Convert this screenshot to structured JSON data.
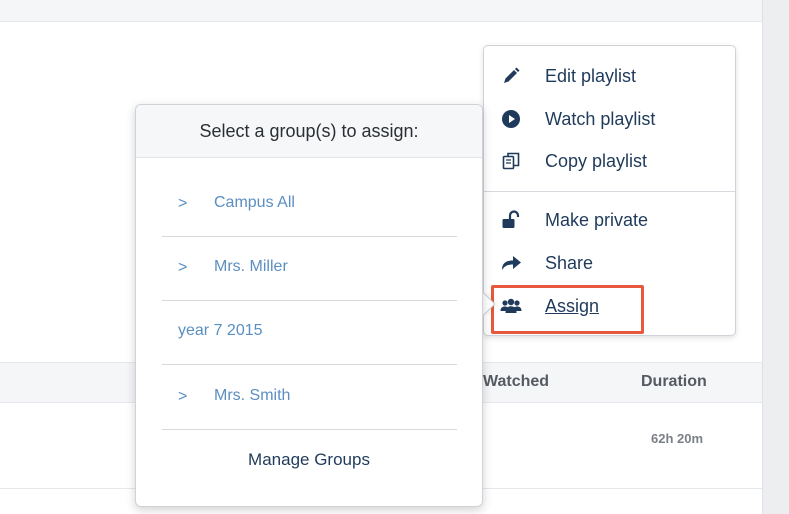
{
  "action_menu": {
    "items": [
      {
        "label": "Edit playlist",
        "icon": "pencil-icon"
      },
      {
        "label": "Watch playlist",
        "icon": "play-circle-icon"
      },
      {
        "label": "Copy playlist",
        "icon": "copy-icon"
      },
      {
        "label": "Make private",
        "icon": "unlock-icon"
      },
      {
        "label": "Share",
        "icon": "share-arrow-icon"
      },
      {
        "label": "Assign",
        "icon": "users-icon"
      }
    ],
    "highlight_color": "#e8583d"
  },
  "group_popover": {
    "title": "Select a group(s) to assign:",
    "groups": [
      {
        "name": "Campus All",
        "expandable": true
      },
      {
        "name": "Mrs. Miller",
        "expandable": true
      },
      {
        "name": "year 7 2015",
        "expandable": false
      },
      {
        "name": "Mrs. Smith",
        "expandable": true
      }
    ],
    "manage_label": "Manage Groups",
    "chevron": ">"
  },
  "table": {
    "headers": {
      "watched": "Watched",
      "duration": "Duration"
    },
    "rows": [
      {
        "duration": "62h 20m"
      }
    ]
  },
  "colors": {
    "link": "#5b8ec1",
    "text_dark": "#1f3a5a"
  }
}
